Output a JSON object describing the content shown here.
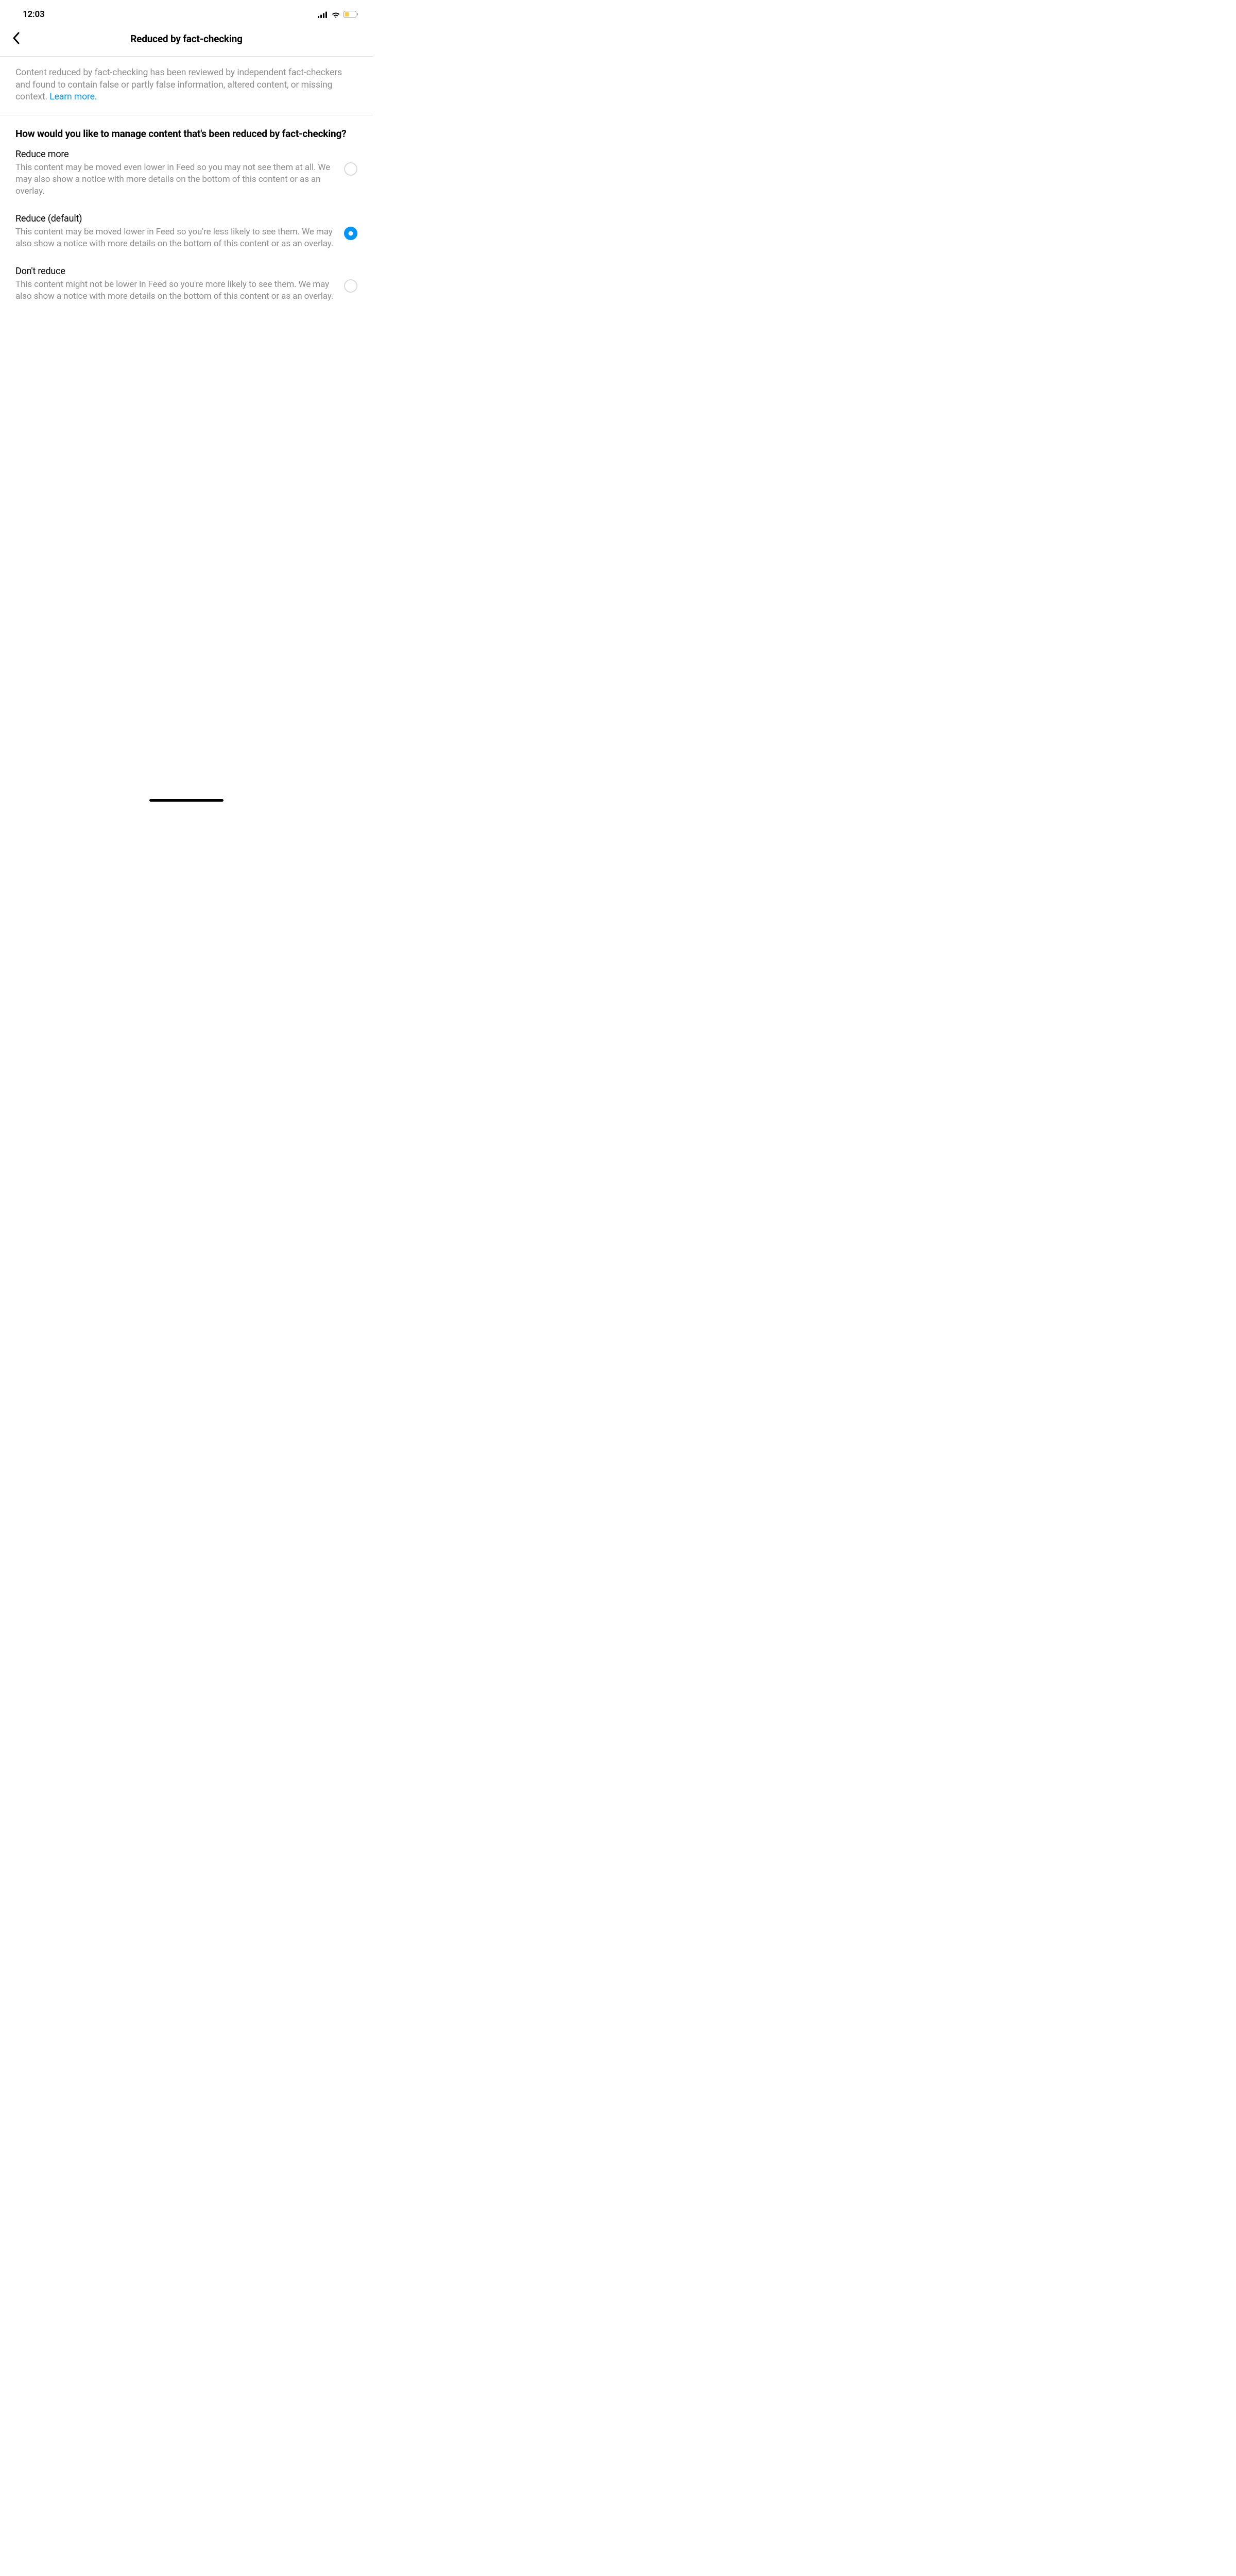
{
  "status_bar": {
    "time": "12:03"
  },
  "header": {
    "title": "Reduced by fact-checking"
  },
  "description": {
    "text": "Content reduced by fact-checking has been reviewed by independent fact-checkers and found to contain false or partly false information, altered content, or missing context. ",
    "learn_more": "Learn more."
  },
  "question": {
    "title": "How would you like to manage content that's been reduced by fact-checking?"
  },
  "options": [
    {
      "title": "Reduce more",
      "description": "This content may be moved even lower in Feed so you may not see them at all. We may also show a notice with more details on the bottom of this content or as an overlay.",
      "selected": false
    },
    {
      "title": "Reduce (default)",
      "description": "This content may be moved lower in Feed so you're less likely to see them. We may also show a notice with more details on the bottom of this content or as an overlay.",
      "selected": true
    },
    {
      "title": "Don't reduce",
      "description": "This content might not be lower in Feed so you're more likely to see them. We may also show a notice with more details on the bottom of this content or as an overlay.",
      "selected": false
    }
  ]
}
